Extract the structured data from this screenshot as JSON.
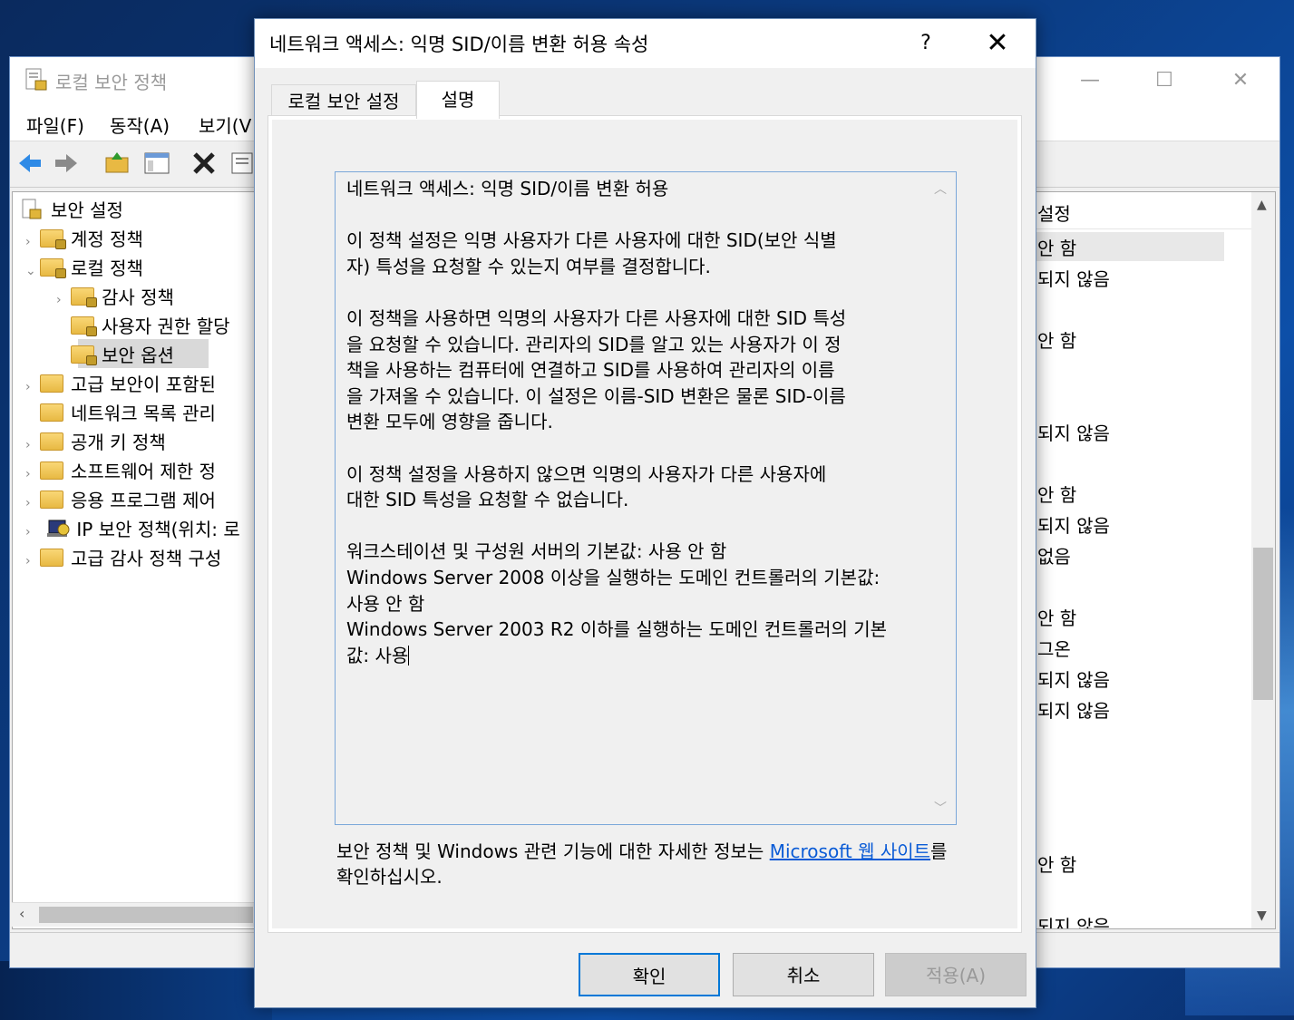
{
  "mmc": {
    "title": "로컬 보안 정책",
    "menu": [
      "파일(F)",
      "동작(A)",
      "보기(V"
    ],
    "window_controls": {
      "minimize": "—",
      "maximize": "☐",
      "close": "✕"
    },
    "tree": {
      "root": "보안 설정",
      "items": [
        {
          "label": "계정 정책",
          "arrow": "›"
        },
        {
          "label": "로컬 정책",
          "arrow": "⌄"
        },
        {
          "label": "감사 정책",
          "arrow": "›"
        },
        {
          "label": "사용자 권한 할당",
          "arrow": ""
        },
        {
          "label": "보안 옵션",
          "arrow": "",
          "selected": true
        },
        {
          "label": "고급 보안이 포함된",
          "arrow": "›"
        },
        {
          "label": "네트워크 목록 관리",
          "arrow": ""
        },
        {
          "label": "공개 키 정책",
          "arrow": "›"
        },
        {
          "label": "소프트웨어 제한 정",
          "arrow": "›"
        },
        {
          "label": "응용 프로그램 제어",
          "arrow": "›"
        },
        {
          "label": "IP 보안 정책(위치: 로",
          "arrow": "›"
        },
        {
          "label": "고급 감사 정책 구성",
          "arrow": "›"
        }
      ]
    },
    "right_pane": {
      "header": "설정",
      "rows": [
        "안 함",
        "되지 않음",
        "안 함",
        "되지 않음",
        "안 함",
        "되지 않음",
        "없음",
        "안 함",
        "그온",
        "되지 않음",
        "되지 않음",
        "안 함",
        "되지 않음"
      ]
    }
  },
  "dialog": {
    "title": "네트워크 액세스: 익명 SID/이름 변환 허용 속성",
    "help": "?",
    "close": "✕",
    "tabs": {
      "local_setting": "로컬 보안 설정",
      "explain": "설명"
    },
    "explain_text": "네트워크 액세스: 익명 SID/이름 변환 허용\n\n이 정책 설정은 익명 사용자가 다른 사용자에 대한 SID(보안 식별\n자) 특성을 요청할 수 있는지 여부를 결정합니다.\n\n이 정책을 사용하면 익명의 사용자가 다른 사용자에 대한 SID 특성\n을 요청할 수 있습니다. 관리자의 SID를 알고 있는 사용자가 이 정\n책을 사용하는 컴퓨터에 연결하고 SID를 사용하여 관리자의 이름\n을 가져올 수 있습니다. 이 설정은 이름-SID 변환은 물론 SID-이름\n변환 모두에 영향을 줍니다.\n\n이 정책 설정을 사용하지 않으면 익명의 사용자가 다른 사용자에\n대한 SID 특성을 요청할 수 없습니다.\n\n워크스테이션 및 구성원 서버의 기본값: 사용 안 함\nWindows Server 2008 이상을 실행하는 도메인 컨트롤러의 기본값:\n사용 안 함\nWindows Server 2003 R2 이하를 실행하는 도메인 컨트롤러의 기본\n값: 사용",
    "footer_before": "보안 정책 및 Windows 관련 기능에 대한 자세한 정보는 ",
    "footer_link": "Microsoft 웹 사이트",
    "footer_after": "를 확인하십시오.",
    "buttons": {
      "ok": "확인",
      "cancel": "취소",
      "apply": "적용(A)"
    }
  },
  "colors": {
    "accent": "#0078d7",
    "link": "#0a5bd6",
    "desktop": "#0b3d85"
  }
}
